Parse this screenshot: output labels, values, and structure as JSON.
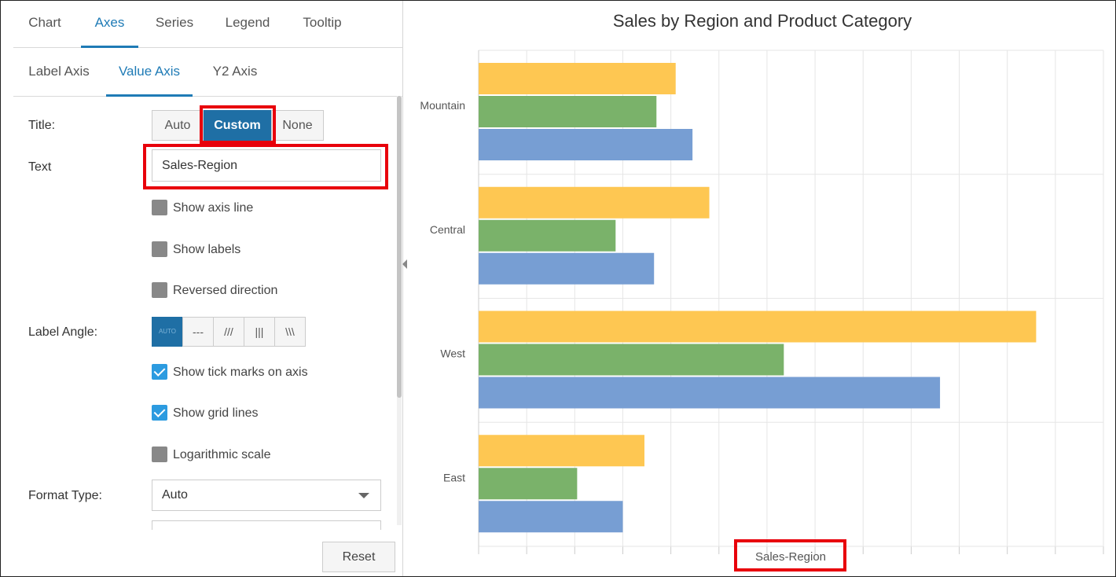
{
  "tabs_primary": [
    "Chart",
    "Axes",
    "Series",
    "Legend",
    "Tooltip"
  ],
  "tabs_secondary": [
    "Label Axis",
    "Value Axis",
    "Y2 Axis"
  ],
  "form": {
    "title_label": "Title:",
    "title_options": [
      "Auto",
      "Custom",
      "None"
    ],
    "title_selected": "Custom",
    "text_label": "Text",
    "text_value": "Sales-Region",
    "checkboxes": [
      {
        "label": "Show axis line",
        "checked": false
      },
      {
        "label": "Show labels",
        "checked": false
      },
      {
        "label": "Reversed direction",
        "checked": false
      },
      {
        "label": "Show tick marks on axis",
        "checked": true
      },
      {
        "label": "Show grid lines",
        "checked": true
      },
      {
        "label": "Logarithmic scale",
        "checked": false
      }
    ],
    "label_angle_label": "Label Angle:",
    "label_angle_options": [
      "AUTO",
      "---",
      "///",
      "|||",
      "\\\\\\"
    ],
    "label_angle_selected": "AUTO",
    "format_type_label": "Format Type:",
    "format_type_value": "Auto",
    "reset_label": "Reset"
  },
  "colors": {
    "accent": "#1f7bb6",
    "highlight": "#e8000b",
    "series_yellow": "#fec752",
    "series_green": "#7ab26a",
    "series_blue": "#779ed3"
  },
  "chart_data": {
    "type": "bar",
    "orientation": "horizontal",
    "title": "Sales by Region and Product Category",
    "xlabel": "Sales-Region",
    "categories": [
      "Mountain",
      "Central",
      "West",
      "East"
    ],
    "series": [
      {
        "values": [
          41,
          48,
          116,
          34.5
        ]
      },
      {
        "values": [
          37,
          28.5,
          63.5,
          20.5
        ]
      },
      {
        "values": [
          44.5,
          36.5,
          96,
          30
        ]
      }
    ],
    "xlim": [
      0,
      130
    ],
    "grid": true,
    "show_tick_labels": false
  }
}
